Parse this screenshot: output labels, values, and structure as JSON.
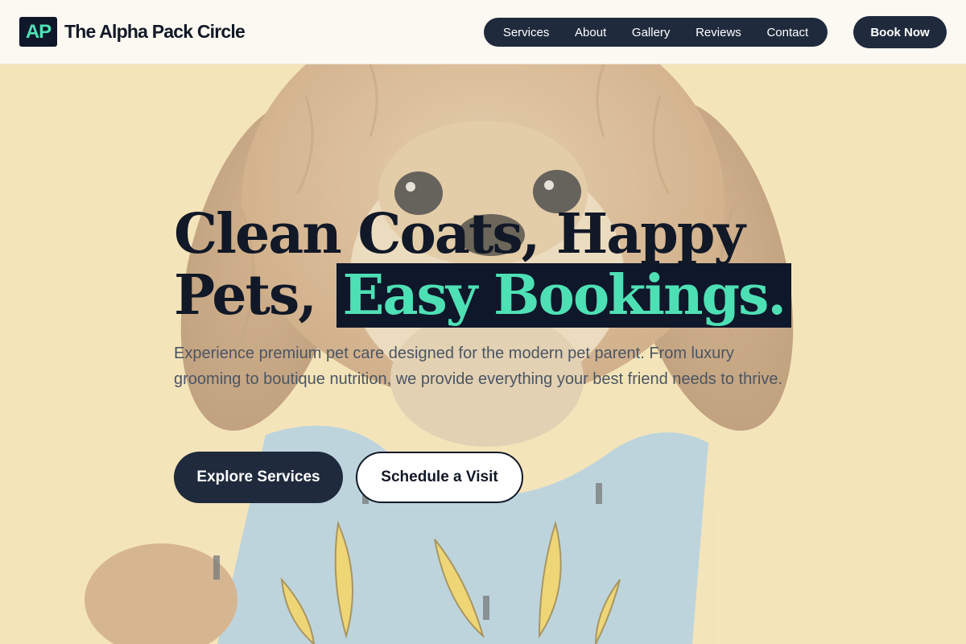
{
  "brand": {
    "logo_text": "AP",
    "name": "The Alpha Pack Circle"
  },
  "nav": {
    "items": [
      {
        "label": "Services"
      },
      {
        "label": "About"
      },
      {
        "label": "Gallery"
      },
      {
        "label": "Reviews"
      },
      {
        "label": "Contact"
      }
    ],
    "cta_label": "Book Now"
  },
  "hero": {
    "headline_line1": "Clean Coats, Happy",
    "headline_line2_prefix": "Pets, ",
    "headline_highlight": "Easy Bookings.",
    "lead": "Experience premium pet care designed for the modern pet parent. From luxury grooming to boutique nutrition, we provide everything your best friend needs to thrive.",
    "primary_cta": "Explore Services",
    "secondary_cta": "Schedule a Visit",
    "background_image": "dog-in-banana-shirt-photo"
  },
  "colors": {
    "navy": "#1f2a3d",
    "ink": "#111827",
    "accent_mint": "#4ee0b5",
    "hero_background": "#f3e2b6",
    "header_background": "#fcf9f2"
  }
}
